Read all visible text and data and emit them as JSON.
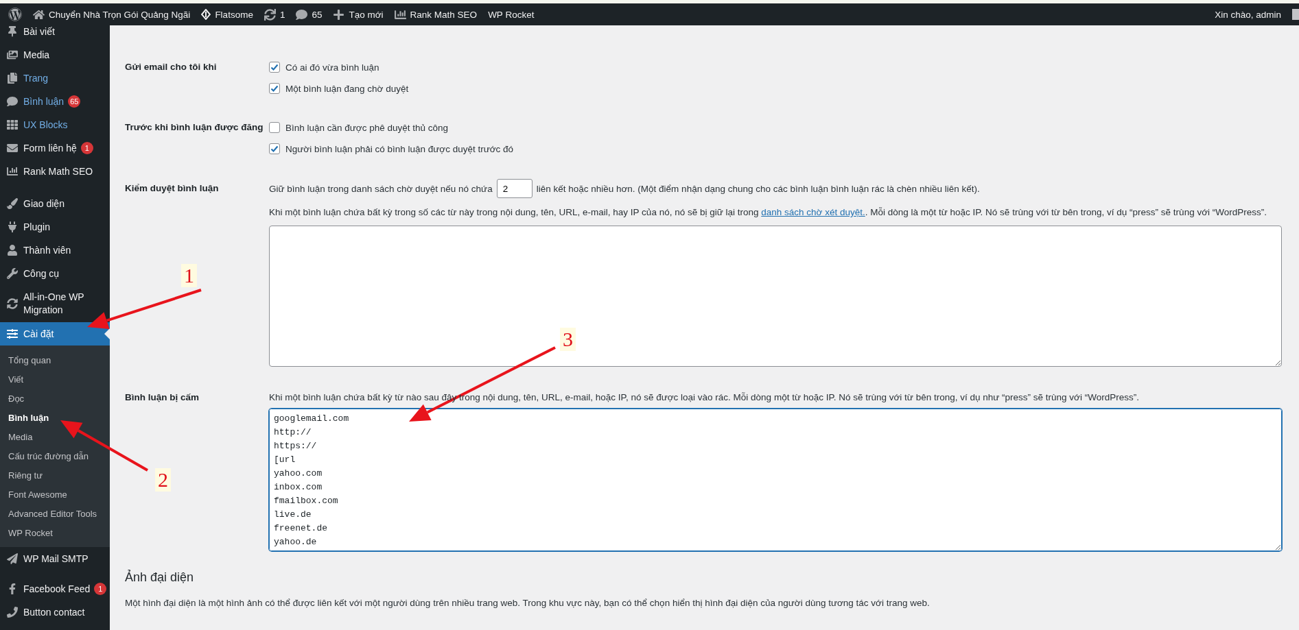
{
  "admin_bar": {
    "site": "Chuyển Nhà Trọn Gói Quảng Ngãi",
    "theme": "Flatsome",
    "updates": "1",
    "comments": "65",
    "new": "Tạo mới",
    "seo": "Rank Math SEO",
    "cache": "WP Rocket",
    "greeting": "Xin chào, admin"
  },
  "sidebar": {
    "groups": [
      [
        {
          "label": "Bài viết",
          "highlighted": false,
          "selected": false
        },
        {
          "label": "Media",
          "highlighted": false,
          "selected": false
        },
        {
          "label": "Trang",
          "highlighted": true,
          "selected": false
        },
        {
          "label": "Bình luận",
          "highlighted": true,
          "selected": false,
          "badge": "65"
        },
        {
          "label": "UX Blocks",
          "highlighted": true,
          "selected": false
        },
        {
          "label": "Form liên hệ",
          "highlighted": false,
          "selected": false,
          "badge": "1"
        },
        {
          "label": "Rank Math SEO",
          "highlighted": false,
          "selected": false
        }
      ],
      [
        {
          "label": "Giao diện",
          "highlighted": false,
          "selected": false
        },
        {
          "label": "Plugin",
          "highlighted": false,
          "selected": false
        },
        {
          "label": "Thành viên",
          "highlighted": false,
          "selected": false
        },
        {
          "label": "Công cụ",
          "highlighted": false,
          "selected": false
        },
        {
          "label": "All-in-One WP Migration",
          "highlighted": false,
          "selected": false
        },
        {
          "label": "Cài đặt",
          "highlighted": false,
          "selected": true,
          "children": [
            {
              "label": "Tổng quan",
              "selected": false
            },
            {
              "label": "Viết",
              "selected": false
            },
            {
              "label": "Đọc",
              "selected": false
            },
            {
              "label": "Bình luận",
              "selected": true
            },
            {
              "label": "Media",
              "selected": false
            },
            {
              "label": "Cấu trúc đường dẫn",
              "selected": false
            },
            {
              "label": "Riêng tư",
              "selected": false
            },
            {
              "label": "Font Awesome",
              "selected": false
            },
            {
              "label": "Advanced Editor Tools",
              "selected": false
            },
            {
              "label": "WP Rocket",
              "selected": false
            }
          ]
        },
        {
          "label": "WP Mail SMTP",
          "highlighted": false,
          "selected": false
        }
      ],
      [
        {
          "label": "Facebook Feed",
          "highlighted": false,
          "selected": false,
          "badge": "1"
        },
        {
          "label": "Button contact",
          "highlighted": false,
          "selected": false
        }
      ]
    ]
  },
  "settings": [
    {
      "kind": "checkboxes",
      "label": "Gửi email cho tôi khi",
      "options": [
        {
          "label": "Có ai đó vừa bình luận",
          "checked": true
        },
        {
          "label": "Một bình luận đang chờ duyệt",
          "checked": true
        }
      ]
    },
    {
      "kind": "checkboxes",
      "label": "Trước khi bình luận được đăng",
      "options": [
        {
          "label": "Bình luận cần được phê duyệt thủ công",
          "checked": false
        },
        {
          "label": "Người bình luận phải có bình luận được duyệt trước đó",
          "checked": true
        }
      ]
    },
    {
      "kind": "moderation",
      "label": "Kiểm duyệt bình luận",
      "before": "Giữ bình luận trong danh sách chờ duyệt nếu nó chứa",
      "value": "2",
      "after": "liên kết hoặc nhiều hơn. (Một điểm nhận dạng chung cho các bình luận bình luận rác là chèn nhiều liên kết).",
      "description": "Khi một bình luận chứa bất kỳ trong số các từ này trong nội dung, tên, URL, e-mail, hay IP của nó, nó sẽ bị giữ lại trong",
      "link": "danh sách chờ xét duyệt.",
      "description_end": ". Mỗi dòng là một từ hoặc IP. Nó sẽ trùng với từ bên trong, ví dụ “press” sẽ trùng với “WordPress”."
    },
    {
      "kind": "blocklist",
      "label": "Bình luận bị cấm",
      "description": "Khi một bình luận chứa bất kỳ từ nào sau đây trong nội dung, tên, URL, e-mail, hoặc IP, nó sẽ được loại vào rác. Mỗi dòng một từ hoặc IP. Nó sẽ trùng với từ bên trong, ví dụ như “press” sẽ trùng với “WordPress”.",
      "lines": [
        "googlemail.com",
        "http://",
        "https://",
        "[url",
        "yahoo.com",
        "inbox.com",
        "fmailbox.com",
        "live.de",
        "freenet.de",
        "yahoo.de"
      ]
    }
  ],
  "avatars": {
    "heading": "Ảnh đại diện",
    "description": "Một hình đại diện là một hình ảnh có thể được liên kết với một người dùng trên nhiều trang web. Trong khu vực này, bạn có thể chọn hiển thị hình đại diện của người dùng tương tác với trang web."
  },
  "annotations": [
    {
      "label": "1"
    },
    {
      "label": "2"
    },
    {
      "label": "3"
    }
  ]
}
